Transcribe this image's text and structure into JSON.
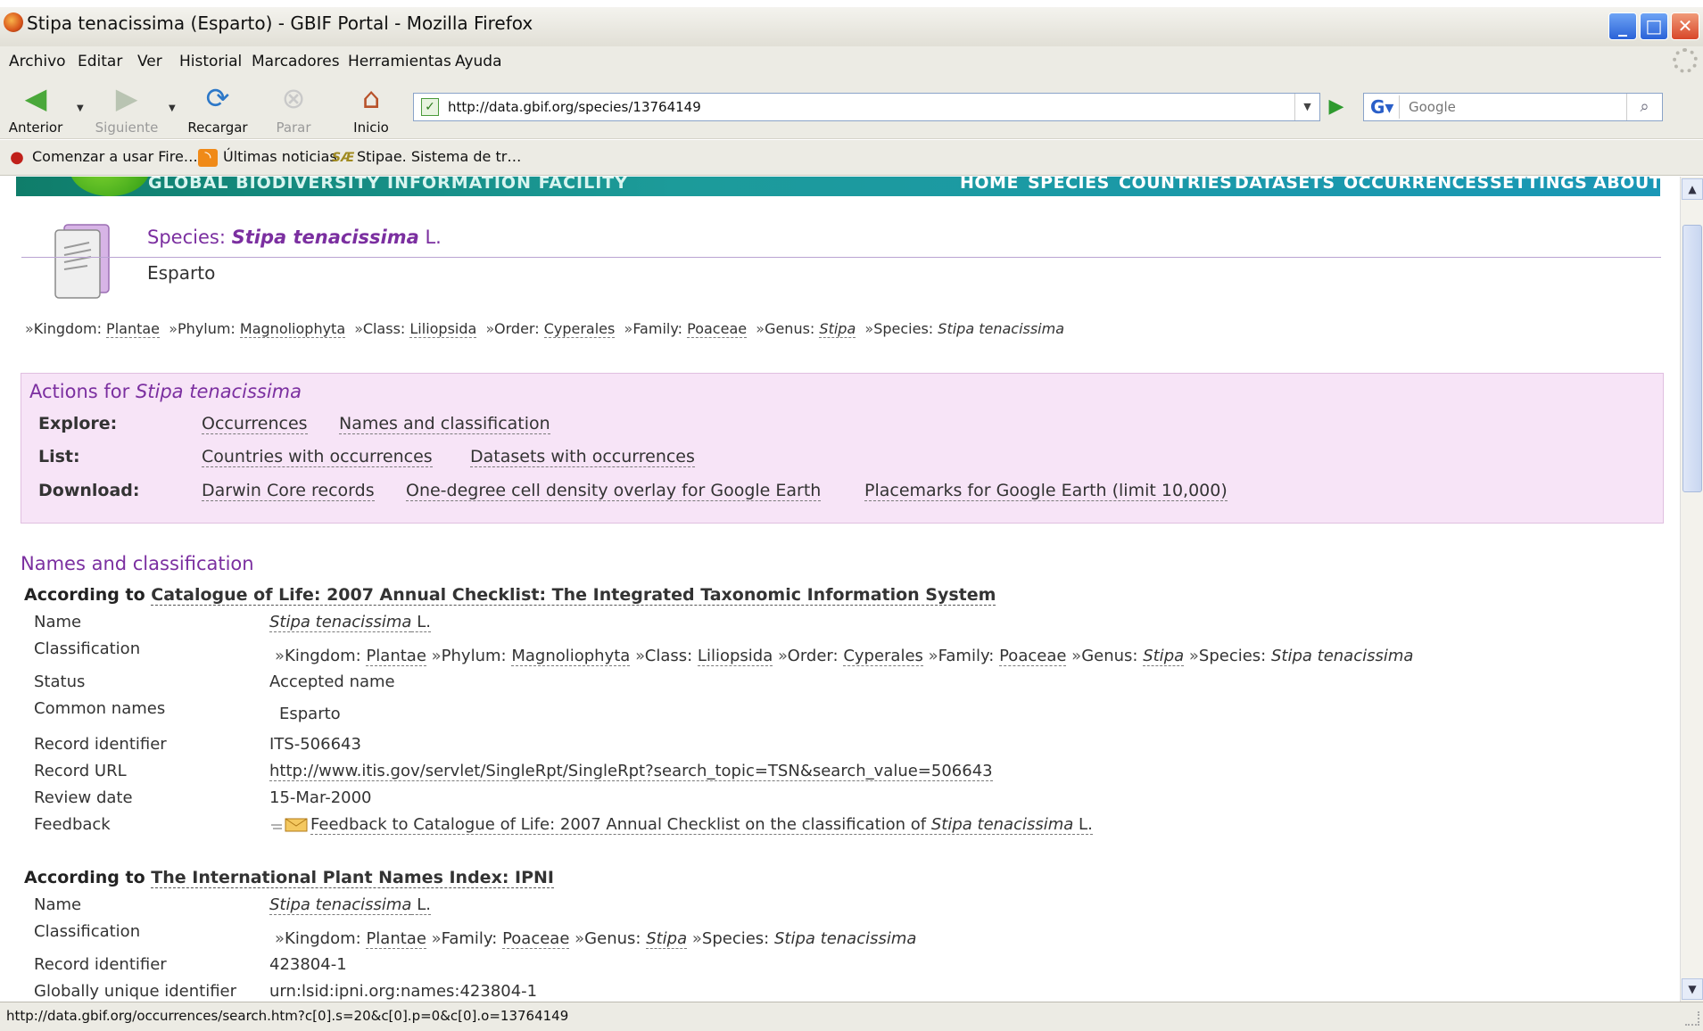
{
  "window": {
    "title": "Stipa tenacissima (Esparto) - GBIF Portal - Mozilla Firefox"
  },
  "menu": [
    "Archivo",
    "Editar",
    "Ver",
    "Historial",
    "Marcadores",
    "Herramientas",
    "Ayuda"
  ],
  "nav": {
    "back": "Anterior",
    "forward": "Siguiente",
    "reload": "Recargar",
    "stop": "Parar",
    "home": "Inicio",
    "url": "http://data.gbif.org/species/13764149",
    "search_placeholder": "Google"
  },
  "bookmarks": [
    "Comenzar a usar Fire…",
    "Últimas noticias",
    "Stipae. Sistema de tr…"
  ],
  "banner": {
    "text": "GLOBAL BIODIVERSITY INFORMATION FACILITY",
    "links": [
      "HOME",
      "SPECIES",
      "COUNTRIES",
      "DATASETS",
      "OCCURRENCES",
      "SETTINGS",
      "ABOUT"
    ]
  },
  "species": {
    "label": "Species:",
    "name": "Stipa tenacissima",
    "author": "L.",
    "common_name": "Esparto"
  },
  "taxonomy": {
    "kingdom_label": "Kingdom:",
    "kingdom": "Plantae",
    "phylum_label": "Phylum:",
    "phylum": "Magnoliophyta",
    "class_label": "Class:",
    "class": "Liliopsida",
    "order_label": "Order:",
    "order": "Cyperales",
    "family_label": "Family:",
    "family": "Poaceae",
    "genus_label": "Genus:",
    "genus": "Stipa",
    "species_label": "Species:",
    "species": "Stipa tenacissima"
  },
  "actions": {
    "title_prefix": "Actions for",
    "title_species": "Stipa tenacissima",
    "explore_label": "Explore:",
    "explore": [
      "Occurrences",
      "Names and classification"
    ],
    "list_label": "List:",
    "list": [
      "Countries with occurrences",
      "Datasets with occurrences"
    ],
    "download_label": "Download:",
    "download": [
      "Darwin Core records",
      "One-degree cell density overlay for Google Earth",
      "Placemarks for Google Earth (limit 10,000)"
    ]
  },
  "names": {
    "title": "Names and classification",
    "according_prefix": "According to",
    "labels": {
      "name": "Name",
      "classification": "Classification",
      "status": "Status",
      "common_names": "Common names",
      "record_id": "Record identifier",
      "record_url": "Record URL",
      "review_date": "Review date",
      "feedback": "Feedback",
      "guid": "Globally unique identifier"
    },
    "col": {
      "source": "Catalogue of Life: 2007 Annual Checklist: The Integrated Taxonomic Information System",
      "name": "Stipa tenacissima",
      "author": "L.",
      "status": "Accepted name",
      "common_names": "Esparto",
      "record_id": "ITS-506643",
      "record_url": "http://www.itis.gov/servlet/SingleRpt/SingleRpt?search_topic=TSN&search_value=506643",
      "review_date": "15-Mar-2000",
      "feedback_text": "Feedback to Catalogue of Life: 2007 Annual Checklist on the classification of",
      "feedback_species": "Stipa tenacissima",
      "feedback_author": "L."
    },
    "ipni": {
      "source": "The International Plant Names Index: IPNI",
      "name": "Stipa tenacissima",
      "author": "L.",
      "record_id": "423804-1",
      "guid": "urn:lsid:ipni.org:names:423804-1"
    }
  },
  "status_bar": "http://data.gbif.org/occurrences/search.htm?c[0].s=20&c[0].p=0&c[0].o=13764149"
}
